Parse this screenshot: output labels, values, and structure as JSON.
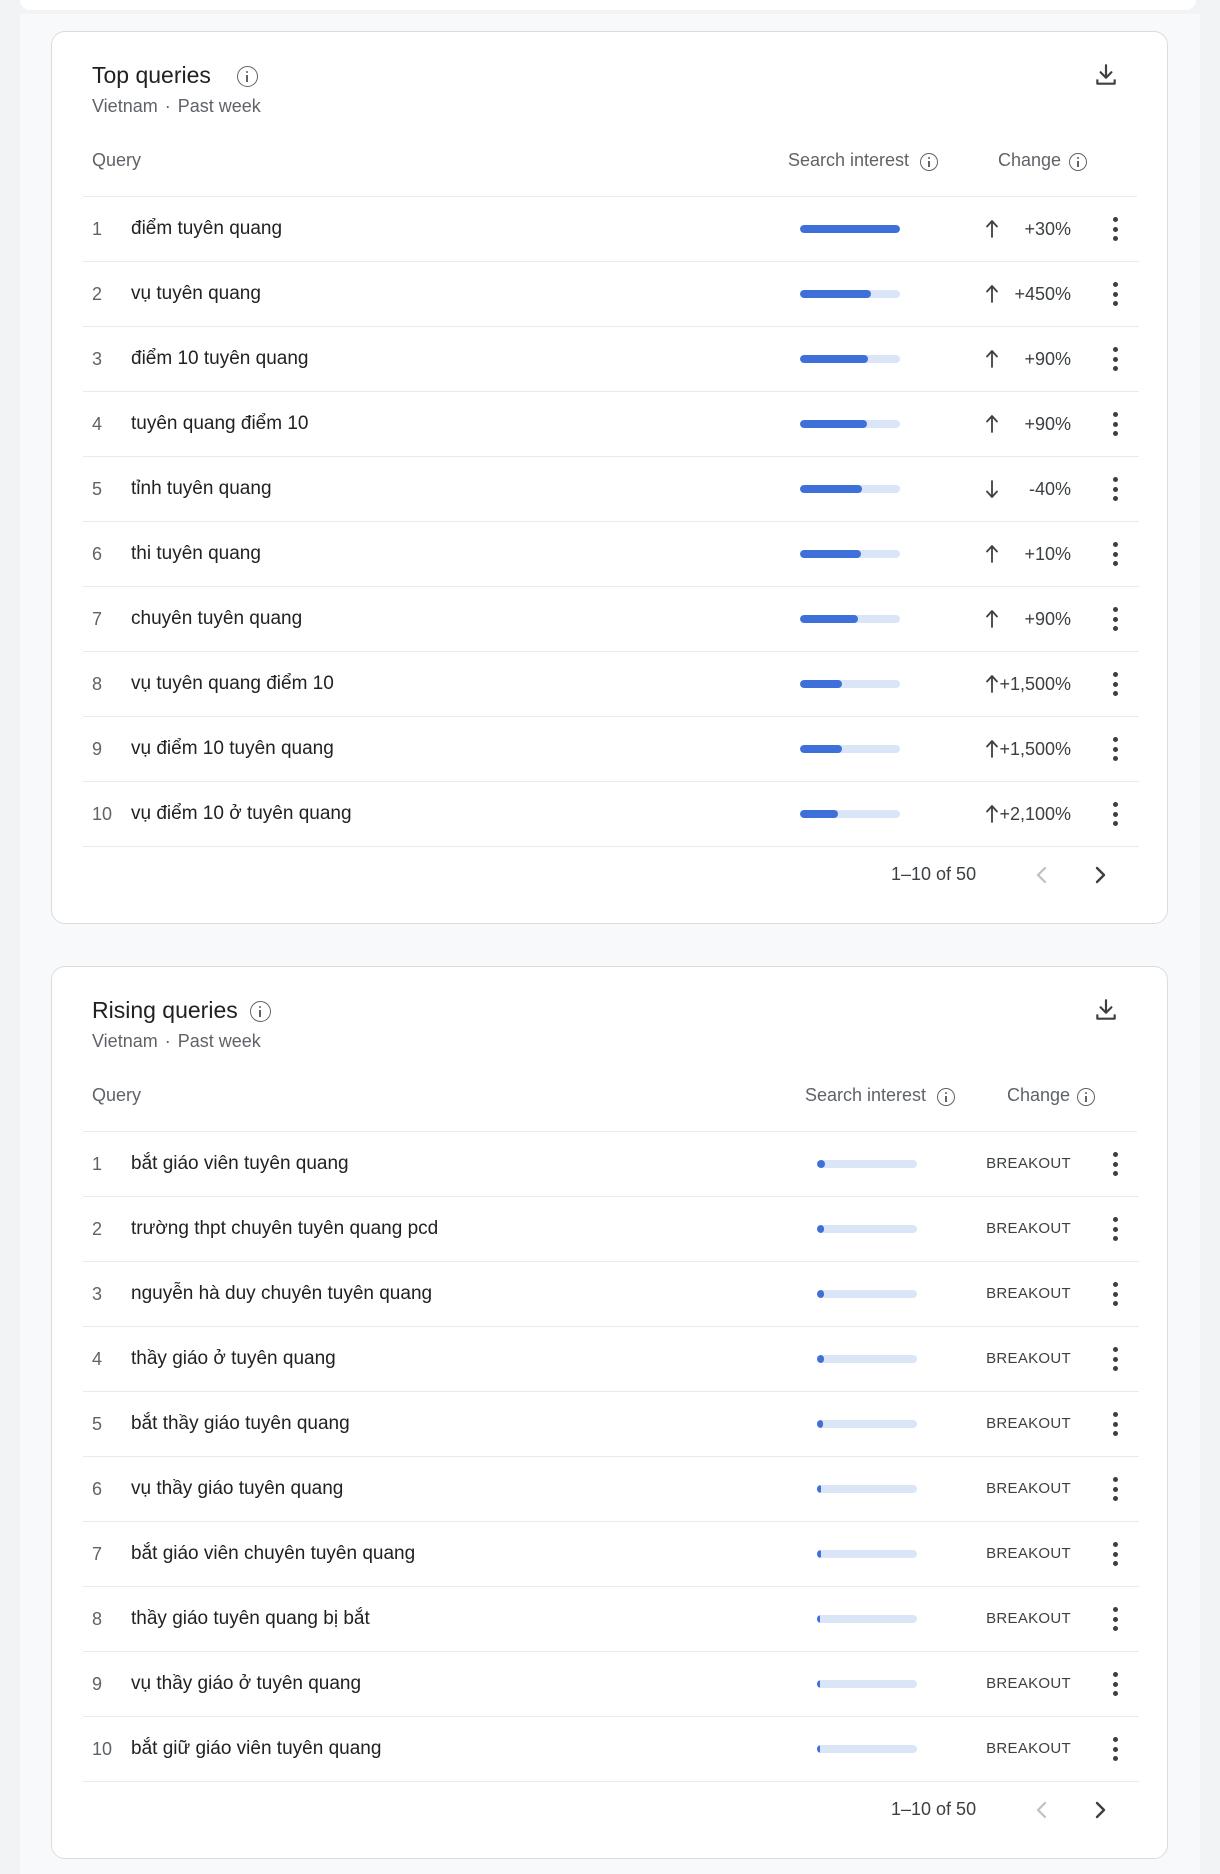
{
  "top_queries": {
    "title": "Top queries",
    "location": "Vietnam",
    "separator": "·",
    "period": "Past week",
    "columns": {
      "query": "Query",
      "interest": "Search interest",
      "change": "Change"
    },
    "rows": [
      {
        "rank": "1",
        "query": "điểm tuyên quang",
        "interest": 100,
        "direction": "up",
        "change": "+30%"
      },
      {
        "rank": "2",
        "query": "vụ tuyên quang",
        "interest": 71,
        "direction": "up",
        "change": "+450%"
      },
      {
        "rank": "3",
        "query": "điểm 10 tuyên quang",
        "interest": 68,
        "direction": "up",
        "change": "+90%"
      },
      {
        "rank": "4",
        "query": "tuyên quang điểm 10",
        "interest": 67,
        "direction": "up",
        "change": "+90%"
      },
      {
        "rank": "5",
        "query": "tỉnh tuyên quang",
        "interest": 62,
        "direction": "down",
        "change": "-40%"
      },
      {
        "rank": "6",
        "query": "thi tuyên quang",
        "interest": 61,
        "direction": "up",
        "change": "+10%"
      },
      {
        "rank": "7",
        "query": "chuyên tuyên quang",
        "interest": 58,
        "direction": "up",
        "change": "+90%"
      },
      {
        "rank": "8",
        "query": "vụ tuyên quang điểm 10",
        "interest": 42,
        "direction": "up",
        "change": "+1,500%"
      },
      {
        "rank": "9",
        "query": "vụ điểm 10 tuyên quang",
        "interest": 42,
        "direction": "up",
        "change": "+1,500%"
      },
      {
        "rank": "10",
        "query": "vụ điểm 10 ở tuyên quang",
        "interest": 38,
        "direction": "up",
        "change": "+2,100%"
      }
    ],
    "pagination": "1–10 of 50"
  },
  "rising_queries": {
    "title": "Rising queries",
    "location": "Vietnam",
    "separator": "·",
    "period": "Past week",
    "columns": {
      "query": "Query",
      "interest": "Search interest",
      "change": "Change"
    },
    "rows": [
      {
        "rank": "1",
        "query": "bắt giáo viên tuyên quang",
        "interest": 8,
        "change": "BREAKOUT"
      },
      {
        "rank": "2",
        "query": "trường thpt chuyên tuyên quang pcd",
        "interest": 7,
        "change": "BREAKOUT"
      },
      {
        "rank": "3",
        "query": "nguyễn hà duy chuyên tuyên quang",
        "interest": 7,
        "change": "BREAKOUT"
      },
      {
        "rank": "4",
        "query": "thầy giáo ở tuyên quang",
        "interest": 7,
        "change": "BREAKOUT"
      },
      {
        "rank": "5",
        "query": "bắt thầy giáo tuyên quang",
        "interest": 6,
        "change": "BREAKOUT"
      },
      {
        "rank": "6",
        "query": "vụ thầy giáo tuyên quang",
        "interest": 4,
        "change": "BREAKOUT"
      },
      {
        "rank": "7",
        "query": "bắt giáo viên chuyên tuyên quang",
        "interest": 4,
        "change": "BREAKOUT"
      },
      {
        "rank": "8",
        "query": "thầy giáo tuyên quang bị bắt",
        "interest": 3,
        "change": "BREAKOUT"
      },
      {
        "rank": "9",
        "query": "vụ thầy giáo ở tuyên quang",
        "interest": 3,
        "change": "BREAKOUT"
      },
      {
        "rank": "10",
        "query": "bắt giữ giáo viên tuyên quang",
        "interest": 3,
        "change": "BREAKOUT"
      }
    ],
    "pagination": "1–10 of 50"
  },
  "colors": {
    "bar_fill": "#3f6fd8",
    "bar_track": "#dbe5f8",
    "border": "#dadce0",
    "text_muted": "#5f6368"
  },
  "icons": [
    "info-icon",
    "download-icon",
    "arrow-up-icon",
    "arrow-down-icon",
    "more-vert-icon",
    "chevron-left-icon",
    "chevron-right-icon"
  ]
}
